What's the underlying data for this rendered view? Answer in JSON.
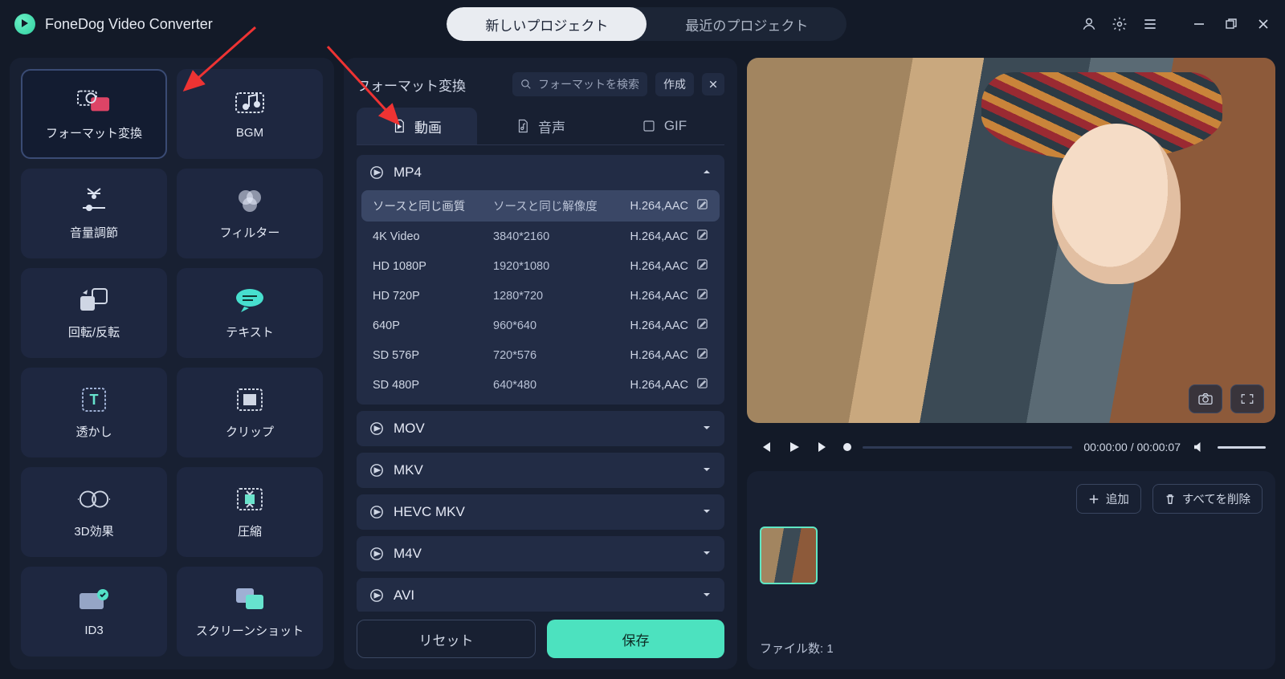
{
  "app": {
    "title": "FoneDog Video Converter"
  },
  "topTabs": {
    "new": "新しいプロジェクト",
    "recent": "最近のプロジェクト"
  },
  "tools": [
    {
      "id": "format",
      "label": "フォーマット変換",
      "active": true
    },
    {
      "id": "bgm",
      "label": "BGM"
    },
    {
      "id": "volume",
      "label": "音量調節"
    },
    {
      "id": "filter",
      "label": "フィルター"
    },
    {
      "id": "rotate",
      "label": "回転/反転"
    },
    {
      "id": "text",
      "label": "テキスト"
    },
    {
      "id": "watermark",
      "label": "透かし"
    },
    {
      "id": "clip",
      "label": "クリップ"
    },
    {
      "id": "3d",
      "label": "3D効果"
    },
    {
      "id": "compress",
      "label": "圧縮"
    },
    {
      "id": "id3",
      "label": "ID3"
    },
    {
      "id": "shot",
      "label": "スクリーンショット"
    }
  ],
  "panel": {
    "title": "フォーマット変換",
    "searchPlaceholder": "フォーマットを検索",
    "create": "作成",
    "subTabs": {
      "video": "動画",
      "audio": "音声",
      "gif": "GIF"
    }
  },
  "formats": {
    "mp4": {
      "name": "MP4",
      "presets": [
        {
          "quality": "ソースと同じ画質",
          "res": "ソースと同じ解像度",
          "codec": "H.264,AAC",
          "sel": true
        },
        {
          "quality": "4K Video",
          "res": "3840*2160",
          "codec": "H.264,AAC"
        },
        {
          "quality": "HD 1080P",
          "res": "1920*1080",
          "codec": "H.264,AAC"
        },
        {
          "quality": "HD 720P",
          "res": "1280*720",
          "codec": "H.264,AAC"
        },
        {
          "quality": "640P",
          "res": "960*640",
          "codec": "H.264,AAC"
        },
        {
          "quality": "SD 576P",
          "res": "720*576",
          "codec": "H.264,AAC"
        },
        {
          "quality": "SD 480P",
          "res": "640*480",
          "codec": "H.264,AAC"
        }
      ]
    },
    "collapsed": [
      "MOV",
      "MKV",
      "HEVC MKV",
      "M4V",
      "AVI"
    ]
  },
  "buttons": {
    "reset": "リセット",
    "save": "保存"
  },
  "player": {
    "current": "00:00:00",
    "duration": "00:00:07"
  },
  "tray": {
    "add": "追加",
    "removeAll": "すべてを削除",
    "countLabel": "ファイル数:",
    "count": "1"
  }
}
